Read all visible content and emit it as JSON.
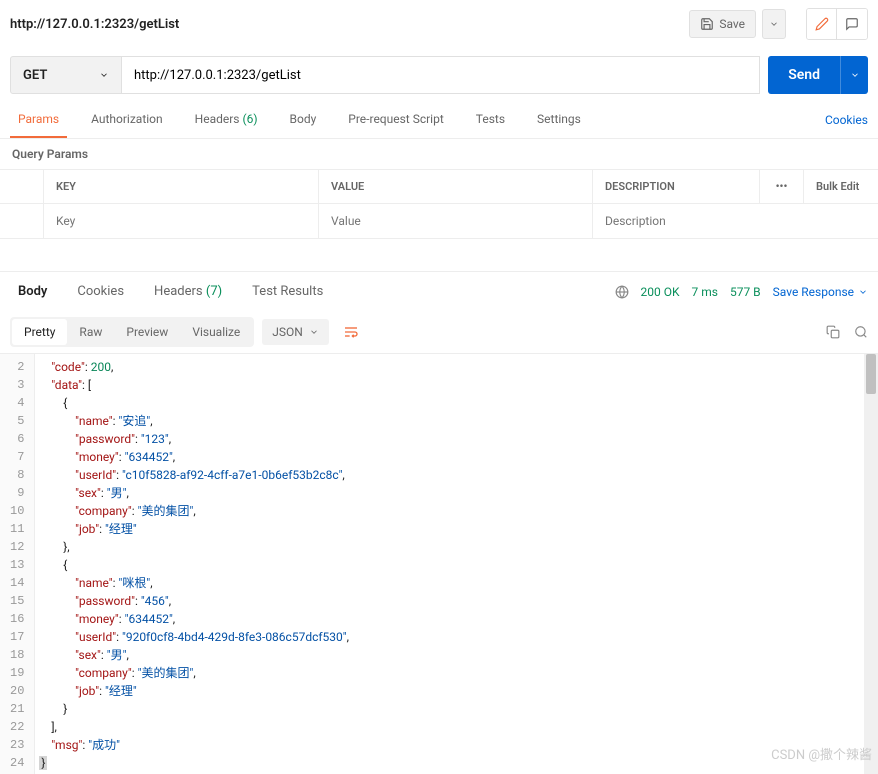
{
  "header": {
    "title": "http://127.0.0.1:2323/getList",
    "save_label": "Save"
  },
  "request": {
    "method": "GET",
    "url": "http://127.0.0.1:2323/getList",
    "send_label": "Send",
    "tabs": {
      "params": "Params",
      "authorization": "Authorization",
      "headers": "Headers",
      "headers_count": "(6)",
      "body": "Body",
      "prerequest": "Pre-request Script",
      "tests": "Tests",
      "settings": "Settings"
    },
    "cookies_link": "Cookies",
    "query_params_title": "Query Params",
    "table": {
      "key_header": "KEY",
      "value_header": "VALUE",
      "desc_header": "DESCRIPTION",
      "bulk_edit": "Bulk Edit",
      "key_placeholder": "Key",
      "value_placeholder": "Value",
      "desc_placeholder": "Description"
    }
  },
  "response": {
    "tabs": {
      "body": "Body",
      "cookies": "Cookies",
      "headers": "Headers",
      "headers_count": "(7)",
      "test_results": "Test Results"
    },
    "status": "200 OK",
    "time": "7 ms",
    "size": "577 B",
    "save_response": "Save Response",
    "view_modes": {
      "pretty": "Pretty",
      "raw": "Raw",
      "preview": "Preview",
      "visualize": "Visualize"
    },
    "format": "JSON",
    "body_json": {
      "code": 200,
      "data": [
        {
          "name": "安追",
          "password": "123",
          "money": "634452",
          "userId": "c10f5828-af92-4cff-a7e1-0b6ef53b2c8c",
          "sex": "男",
          "company": "美的集团",
          "job": "经理"
        },
        {
          "name": "咪根",
          "password": "456",
          "money": "634452",
          "userId": "920f0cf8-4bd4-429d-8fe3-086c57dcf530",
          "sex": "男",
          "company": "美的集团",
          "job": "经理"
        }
      ],
      "msg": "成功"
    },
    "code_lines": [
      {
        "n": 2,
        "html": "    <span class='k'>\"code\"</span><span class='p'>: </span><span class='n'>200</span><span class='p'>,</span>"
      },
      {
        "n": 3,
        "html": "    <span class='k'>\"data\"</span><span class='p'>: [</span>"
      },
      {
        "n": 4,
        "html": "        <span class='p'>{</span>"
      },
      {
        "n": 5,
        "html": "            <span class='k'>\"name\"</span><span class='p'>: </span><span class='s'>\"安追\"</span><span class='p'>,</span>"
      },
      {
        "n": 6,
        "html": "            <span class='k'>\"password\"</span><span class='p'>: </span><span class='s'>\"123\"</span><span class='p'>,</span>"
      },
      {
        "n": 7,
        "html": "            <span class='k'>\"money\"</span><span class='p'>: </span><span class='s'>\"634452\"</span><span class='p'>,</span>"
      },
      {
        "n": 8,
        "html": "            <span class='k'>\"userId\"</span><span class='p'>: </span><span class='s'>\"c10f5828-af92-4cff-a7e1-0b6ef53b2c8c\"</span><span class='p'>,</span>"
      },
      {
        "n": 9,
        "html": "            <span class='k'>\"sex\"</span><span class='p'>: </span><span class='s'>\"男\"</span><span class='p'>,</span>"
      },
      {
        "n": 10,
        "html": "            <span class='k'>\"company\"</span><span class='p'>: </span><span class='s'>\"美的集团\"</span><span class='p'>,</span>"
      },
      {
        "n": 11,
        "html": "            <span class='k'>\"job\"</span><span class='p'>: </span><span class='s'>\"经理\"</span>"
      },
      {
        "n": 12,
        "html": "        <span class='p'>},</span>"
      },
      {
        "n": 13,
        "html": "        <span class='p'>{</span>"
      },
      {
        "n": 14,
        "html": "            <span class='k'>\"name\"</span><span class='p'>: </span><span class='s'>\"咪根\"</span><span class='p'>,</span>"
      },
      {
        "n": 15,
        "html": "            <span class='k'>\"password\"</span><span class='p'>: </span><span class='s'>\"456\"</span><span class='p'>,</span>"
      },
      {
        "n": 16,
        "html": "            <span class='k'>\"money\"</span><span class='p'>: </span><span class='s'>\"634452\"</span><span class='p'>,</span>"
      },
      {
        "n": 17,
        "html": "            <span class='k'>\"userId\"</span><span class='p'>: </span><span class='s'>\"920f0cf8-4bd4-429d-8fe3-086c57dcf530\"</span><span class='p'>,</span>"
      },
      {
        "n": 18,
        "html": "            <span class='k'>\"sex\"</span><span class='p'>: </span><span class='s'>\"男\"</span><span class='p'>,</span>"
      },
      {
        "n": 19,
        "html": "            <span class='k'>\"company\"</span><span class='p'>: </span><span class='s'>\"美的集团\"</span><span class='p'>,</span>"
      },
      {
        "n": 20,
        "html": "            <span class='k'>\"job\"</span><span class='p'>: </span><span class='s'>\"经理\"</span>"
      },
      {
        "n": 21,
        "html": "        <span class='p'>}</span>"
      },
      {
        "n": 22,
        "html": "    <span class='p'>],</span>"
      },
      {
        "n": 23,
        "html": "    <span class='k'>\"msg\"</span><span class='p'>: </span><span class='s'>\"成功\"</span>"
      },
      {
        "n": 24,
        "html": "<span class='cursor-box p'>}</span>"
      }
    ]
  },
  "watermark": "CSDN @撒个辣酱"
}
